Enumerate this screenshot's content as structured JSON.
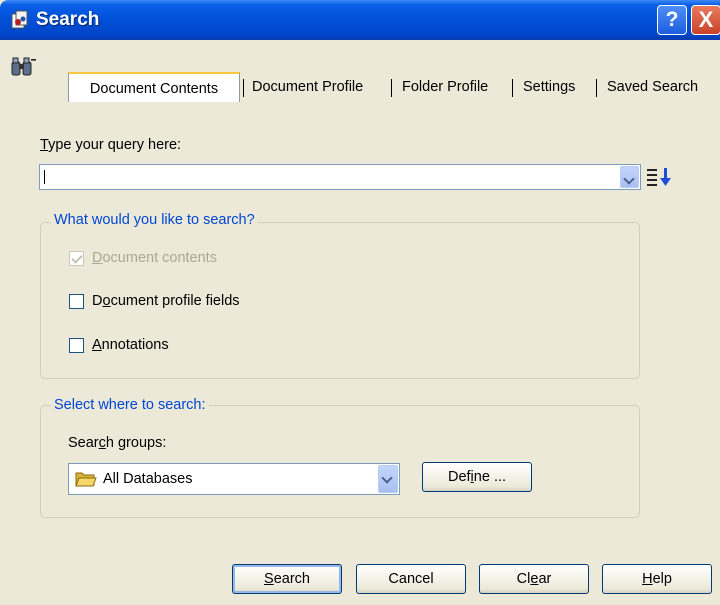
{
  "window": {
    "title": "Search",
    "help_label": "?",
    "close_label": "X"
  },
  "tabs": [
    {
      "label": "Document Contents",
      "active": true
    },
    {
      "label": "Document Profile",
      "active": false
    },
    {
      "label": "Folder Profile",
      "active": false
    },
    {
      "label": "Settings",
      "active": false
    },
    {
      "label": "Saved Search",
      "active": false
    }
  ],
  "query": {
    "label_prefix": "",
    "label_underlined": "T",
    "label_rest": "ype your query here:",
    "value": ""
  },
  "search_what": {
    "legend": "What would you like to search?",
    "options": [
      {
        "u": "D",
        "rest": "ocument contents",
        "checked": true,
        "disabled": true
      },
      {
        "pre": "D",
        "u": "o",
        "rest": "cument profile fields",
        "checked": false,
        "disabled": false
      },
      {
        "u": "A",
        "rest": "nnotations",
        "checked": false,
        "disabled": false
      }
    ]
  },
  "search_where": {
    "legend": "Select where to search:",
    "groups_label_pre": "Sear",
    "groups_label_u": "c",
    "groups_label_rest": "h groups:",
    "selected_group": "All Databases",
    "define_pre": "Def",
    "define_u": "i",
    "define_rest": "ne ..."
  },
  "buttons": {
    "search_u": "S",
    "search_rest": "earch",
    "cancel": "Cancel",
    "clear_pre": "Cl",
    "clear_u": "e",
    "clear_rest": "ar",
    "help_u": "H",
    "help_rest": "elp"
  },
  "colors": {
    "title_bar": "#0050d8",
    "legend_text": "#0046d5",
    "dialog_bg": "#ECE9D8"
  },
  "icons": {
    "title": "search-dialog-icon",
    "tab_strip": "binoculars-icon",
    "sort": "sort-descending-icon",
    "folder": "folder-open-icon"
  }
}
